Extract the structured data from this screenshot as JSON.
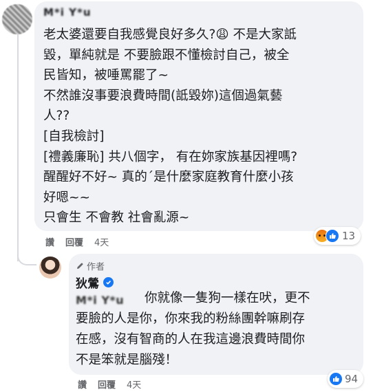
{
  "comment": {
    "author_name": "M*i Y*u",
    "body": "老太婆還要自我感覺良好多久?😩 不是大家詆\n毀，單純就是 不要臉跟不懂檢討自己，被全\n民皆知，被唾罵罷了~\n不然誰沒事要浪費時間(詆毀妳)這個過氣藝\n人??\n[自我檢討]\n[禮義廉恥] 共八個字， 有在妳家族基因裡嗎?\n醒醒好不好~ 真的´是什麼家庭教育什麼小孩\n好嗯~~\n只會生 不會教 社會亂源~",
    "actions": {
      "like": "讚",
      "reply": "回覆",
      "time": "4天"
    },
    "reaction_count": "13",
    "reaction_icons": [
      "angry-emoji",
      "like-emoji"
    ]
  },
  "reply": {
    "author_tag": "作者",
    "author_name": "狄鶯",
    "mention": "M*i Y*u",
    "body": "你就像一隻狗一樣在吠，更不\n要臉的人是你，你來我的粉絲團幹嘛刷存\n在感，沒有智商的人在我這邊浪費時間你\n不是笨就是腦殘！",
    "actions": {
      "like": "讚",
      "reply": "回覆",
      "time": "4天"
    },
    "reaction_count": "94",
    "reaction_icons": [
      "like-emoji"
    ]
  },
  "colors": {
    "bubble": "#f0f2f5",
    "meta_text": "#65676b",
    "accent": "#1877f2",
    "angry": "#e9710f"
  }
}
